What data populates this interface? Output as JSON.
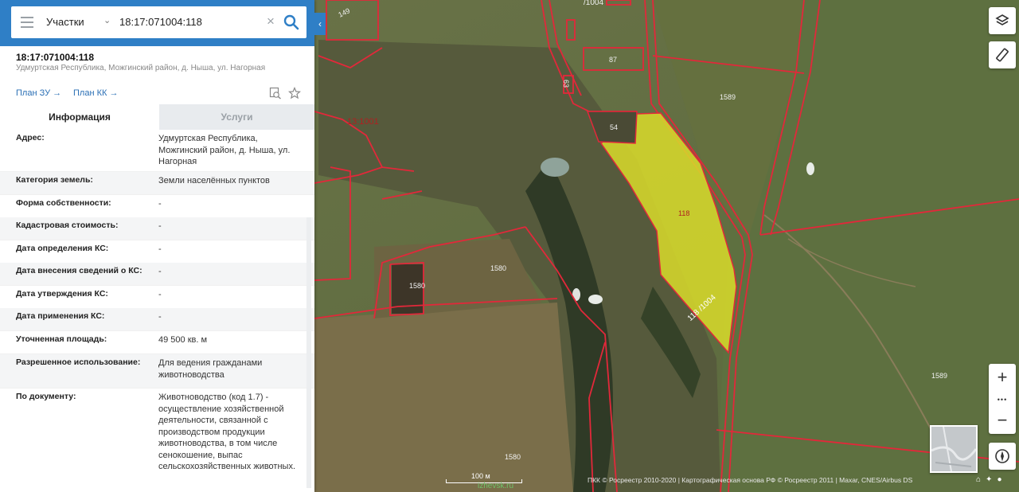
{
  "search": {
    "type_label": "Участки",
    "value": "18:17:071004:118",
    "clear_glyph": "×"
  },
  "object": {
    "cadastral_number": "18:17:071004:118",
    "address_short": "Удмуртская Республика, Можгинский район, д. Ныша, ул. Нагорная"
  },
  "links": {
    "plan_zu": "План ЗУ →",
    "plan_kk": "План КК →"
  },
  "tabs": {
    "info": "Информация",
    "services": "Услуги"
  },
  "info_rows": [
    {
      "label": "Адрес:",
      "value": "Удмуртская Республика, Можгинский район, д. Ныша, ул. Нагорная"
    },
    {
      "label": "Категория земель:",
      "value": "Земли населённых пунктов"
    },
    {
      "label": "Форма собственности:",
      "value": "-"
    },
    {
      "label": "Кадастровая стоимость:",
      "value": "-"
    },
    {
      "label": "Дата определения КС:",
      "value": "-"
    },
    {
      "label": "Дата внесения сведений о КС:",
      "value": "-"
    },
    {
      "label": "Дата утверждения КС:",
      "value": "-"
    },
    {
      "label": "Дата применения КС:",
      "value": "-"
    },
    {
      "label": "Уточненная площадь:",
      "value": "49 500 кв. м"
    },
    {
      "label": "Разрешенное использование:",
      "value": "Для ведения гражданами животноводства"
    },
    {
      "label": "По документу:",
      "value": "Животноводство (код 1.7) - осуществление хозяйственной деятельности, связанной с производством продукции животноводства, в том числе сенокошение, выпас сельскохозяйственных животных."
    }
  ],
  "map_labels": {
    "parcel": "118",
    "parcel_edge": "118 /1004",
    "l1589a": "1589",
    "l1589b": "1589",
    "l1580a": "1580",
    "l1580b": "1580",
    "l1580c": "1580",
    "l54": "54",
    "l87": "87",
    "l63": "63",
    "block": "13:1001",
    "l1004": "/1004",
    "l149": "149"
  },
  "map_controls": {
    "zoom_in": "+",
    "zoom_more": "•••",
    "zoom_out": "−"
  },
  "attribution": "ПКК © Росреестр 2010-2020 | Картографическая основа РФ © Росреестр 2011 | Maxar, CNES/Airbus DS",
  "scale_label": "100 м",
  "watermark": "izhevsk.ru",
  "colors": {
    "accent": "#2f7fc6",
    "parcel_fill": "#d9dc2a",
    "boundary": "#e2283a",
    "satellite_field": "#5f6a3d"
  }
}
